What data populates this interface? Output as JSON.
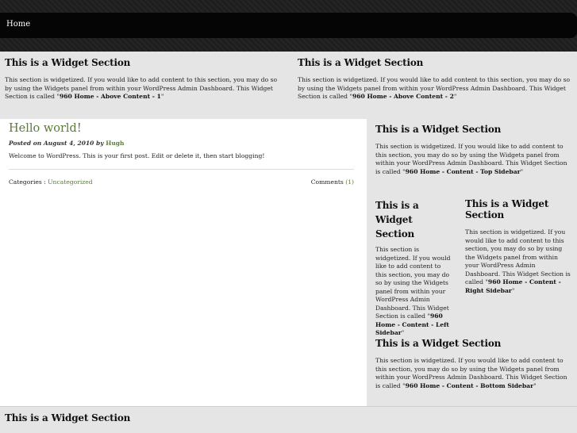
{
  "nav": {
    "home": "Home"
  },
  "widget_title": "This is a Widget Section",
  "top_widgets": [
    {
      "title": "This is a Widget Section",
      "text": "This section is widgetized. If you would like to add content to this section, you may do so by using the Widgets panel from within your WordPress Admin Dashboard. This Widget Section is called \"",
      "name": "960 Home - Above Content - 1",
      "close": "\""
    },
    {
      "title": "This is a Widget Section",
      "text": "This section is widgetized. If you would like to add content to this section, you may do so by using the Widgets panel from within your WordPress Admin Dashboard. This Widget Section is called \"",
      "name": "960 Home - Above Content - 2",
      "close": "\""
    }
  ],
  "post": {
    "title": "Hello world!",
    "posted_on_label": "Posted on August 4, 2010 by ",
    "author": "Hugh",
    "body": "Welcome to WordPress. This is your first post. Edit or delete it, then start blogging!",
    "categories_label": "Categories : ",
    "category": "Uncategorized",
    "comments_label": "Comments ",
    "comments_count": "(1)"
  },
  "sidebar": {
    "top": {
      "title": "This is a Widget Section",
      "text": "This section is widgetized. If you would like to add content to this section, you may do so by using the Widgets panel from within your WordPress Admin Dashboard. This Widget Section is called \"",
      "name": "960 Home - Content - Top Sidebar",
      "close": "\""
    },
    "left": {
      "title": "This is a Widget Section",
      "text": "This section is widgetized. If you would like to add content to this section, you may do so by using the Widgets panel from within your WordPress Admin Dashboard. This Widget Section is called \"",
      "name": "960 Home - Content - Left Sidebar",
      "close": "\""
    },
    "right": {
      "title": "This is a Widget Section",
      "text": "This section is widgetized. If you would like to add content to this section, you may do so by using the Widgets panel from within your WordPress Admin Dashboard. This Widget Section is called \"",
      "name": "960 Home - Content - Right Sidebar",
      "close": "\""
    },
    "bottom": {
      "title": "This is a Widget Section",
      "text": "This section is widgetized. If you would like to add content to this section, you may do so by using the Widgets panel from within your WordPress Admin Dashboard. This Widget Section is called \"",
      "name": "960 Home - Content - Bottom Sidebar",
      "close": "\""
    }
  },
  "bottom_widget": {
    "title": "This is a Widget Section"
  }
}
